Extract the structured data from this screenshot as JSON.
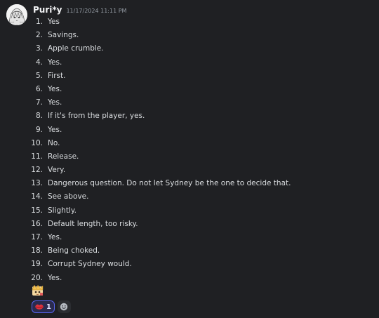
{
  "message": {
    "username": "Puri*y",
    "timestamp": "11/17/2024 11:11 PM",
    "avatar_icon": "anime-character-avatar",
    "items": [
      {
        "num": "1.",
        "text": "Yes"
      },
      {
        "num": "2.",
        "text": "Savings."
      },
      {
        "num": "3.",
        "text": "Apple crumble."
      },
      {
        "num": "4.",
        "text": "Yes."
      },
      {
        "num": "5.",
        "text": "First."
      },
      {
        "num": "6.",
        "text": "Yes."
      },
      {
        "num": "7.",
        "text": "Yes."
      },
      {
        "num": "8.",
        "text": "If it's from the player, yes."
      },
      {
        "num": "9.",
        "text": "Yes."
      },
      {
        "num": "10.",
        "text": "No."
      },
      {
        "num": "11.",
        "text": "Release."
      },
      {
        "num": "12.",
        "text": "Very."
      },
      {
        "num": "13.",
        "text": "Dangerous question. Do not let Sydney be the one to decide that."
      },
      {
        "num": "14.",
        "text": "See above."
      },
      {
        "num": "15.",
        "text": "Slightly."
      },
      {
        "num": "16.",
        "text": "Default length, too risky."
      },
      {
        "num": "17.",
        "text": "Yes."
      },
      {
        "num": "18.",
        "text": "Being choked."
      },
      {
        "num": "19.",
        "text": "Corrupt Sydney would."
      },
      {
        "num": "20.",
        "text": "Yes."
      }
    ],
    "sticker_icon": "emote-sticker-icon",
    "reactions": [
      {
        "icon": "lips-emoji-icon",
        "count": "1"
      }
    ],
    "add_reaction_icon": "add-reaction-smiley-icon"
  },
  "colors": {
    "background": "#1f2023",
    "text": "#dbdee1",
    "username": "#f2f3f5",
    "timestamp": "#949ba4",
    "reaction_bg": "#2a2b4f",
    "reaction_border": "#5865f2"
  }
}
